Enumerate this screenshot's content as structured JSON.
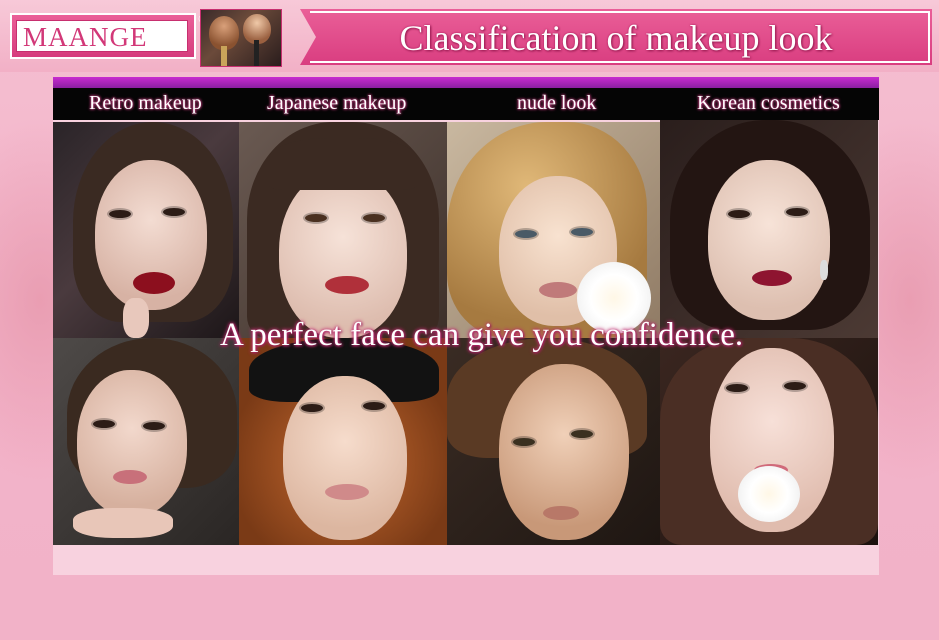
{
  "header": {
    "brand": "MAANGE",
    "trademark": "®",
    "title": "Classification of makeup look"
  },
  "categories": [
    {
      "label": "Retro makeup"
    },
    {
      "label": "Japanese makeup"
    },
    {
      "label": "nude look"
    },
    {
      "label": "Korean cosmetics"
    }
  ],
  "slogan": "A perfect face can give you confidence.",
  "colors": {
    "brand_pink": "#d63c7d",
    "background": "#f2b2c8",
    "category_bar": "#050505",
    "accent_purple": "#c82bd0"
  }
}
